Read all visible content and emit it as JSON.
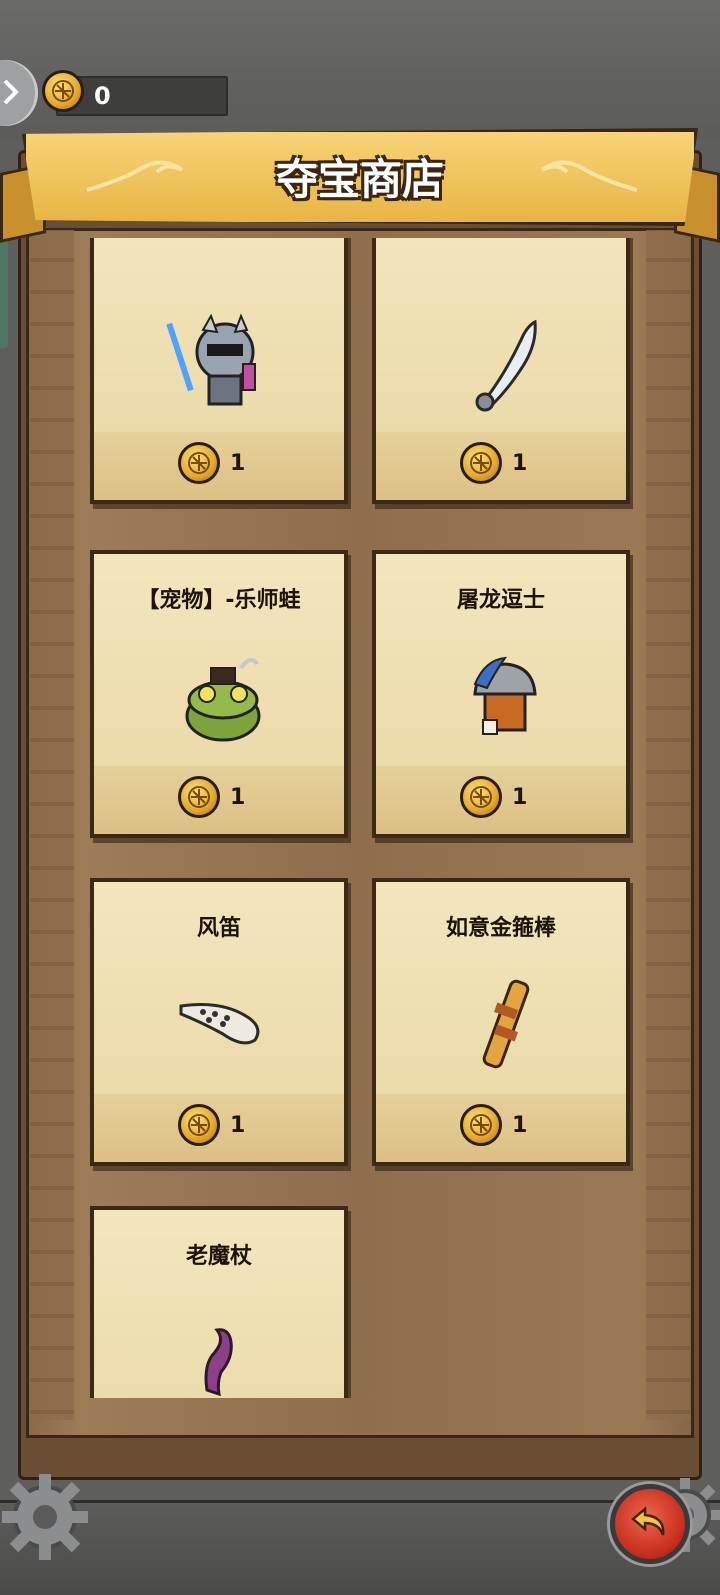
{
  "header": {
    "coin_balance": "0",
    "title": "夺宝商店"
  },
  "shop": {
    "items": [
      {
        "name": "",
        "price": "1"
      },
      {
        "name": "",
        "price": "1"
      },
      {
        "name": "【宠物】-乐师蛙",
        "price": "1"
      },
      {
        "name": "屠龙逗士",
        "price": "1"
      },
      {
        "name": "风笛",
        "price": "1"
      },
      {
        "name": "如意金箍棒",
        "price": "1"
      },
      {
        "name": "老魔杖",
        "price": ""
      }
    ]
  },
  "icons": {
    "back": "chevron-right-icon",
    "coin": "gold-coin-icon",
    "return": "return-arrow-icon",
    "gear": "gear-icon"
  },
  "colors": {
    "banner": "#f0c45c",
    "card": "#f0e1b4",
    "return_button": "#d9392a"
  }
}
